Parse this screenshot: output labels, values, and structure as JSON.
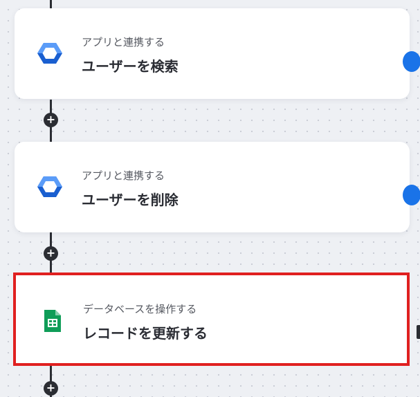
{
  "flow": {
    "steps": [
      {
        "subtitle": "アプリと連携する",
        "title": "ユーザーを検索",
        "icon": "google-admin-hexagon-icon",
        "selected": false
      },
      {
        "subtitle": "アプリと連携する",
        "title": "ユーザーを削除",
        "icon": "google-admin-hexagon-icon",
        "selected": false
      },
      {
        "subtitle": "データベースを操作する",
        "title": "レコードを更新する",
        "icon": "google-sheets-icon",
        "selected": true
      }
    ],
    "add_button_glyph": "+"
  },
  "colors": {
    "background": "#eef0f4",
    "connector": "#2b2d33",
    "highlight": "#e02020",
    "admin_blue_dark": "#1a5fd0",
    "admin_blue_light": "#5b9cf8",
    "sheets_green": "#0f9d58",
    "edge_dot_blue": "#1a73e8"
  }
}
